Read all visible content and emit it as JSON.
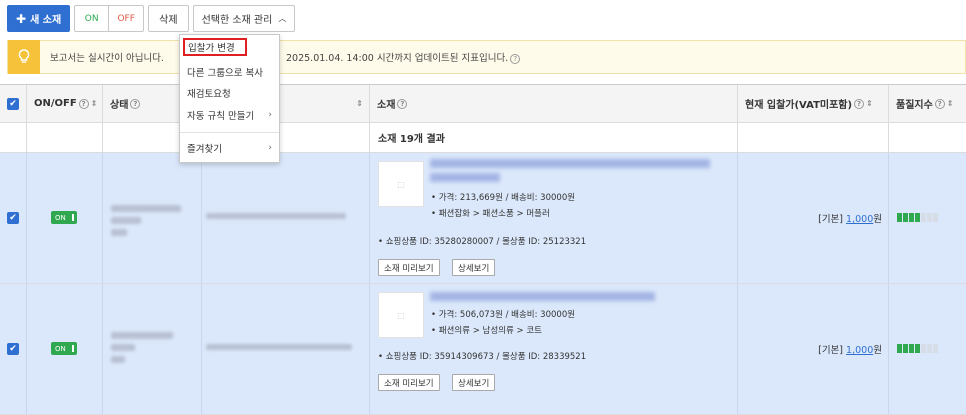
{
  "toolbar": {
    "new_label": "새 소재",
    "on_label": "ON",
    "off_label": "OFF",
    "delete_label": "삭제",
    "manage_label": "선택한 소재 관리"
  },
  "notice": {
    "text_a": "보고서는 실시간이 아닙니다.",
    "text_b": "2025.01.04. 14:00 시간까지 업데이트된 지표입니다."
  },
  "dropdown": {
    "items": [
      "입찰가 변경",
      "다른 그룹으로 복사",
      "재검토요청",
      "자동 규칙 만들기",
      "즐겨찾기"
    ]
  },
  "table": {
    "headers": {
      "onoff": "ON/OFF",
      "status": "상태",
      "material": "소재",
      "bid": "현재 입찰가(VAT미포함)",
      "quality": "품질지수"
    },
    "summary": "소재 19개 결과",
    "rows": [
      {
        "toggle": "ON",
        "price": "• 가격: 213,669원 /  배송비: 30000원",
        "category": "• 패션잡화 > 패션소품 > 머플러",
        "ids": "• 쇼핑상품 ID: 35280280007   / 몰상품 ID: 25123321",
        "preview": "소재 미리보기",
        "detail": "상세보기",
        "bid_prefix": "[기본]",
        "bid_amount": "1,000",
        "bid_unit": "원",
        "quality": 4
      },
      {
        "toggle": "ON",
        "price": "• 가격: 506,073원 /  배송비: 30000원",
        "category": "• 패션의류 > 남성의류 > 코트",
        "ids": "• 쇼핑상품 ID: 35914309673   / 몰상품 ID: 28339521",
        "preview": "소재 미리보기",
        "detail": "상세보기",
        "bid_prefix": "[기본]",
        "bid_amount": "1,000",
        "bid_unit": "원",
        "quality": 4
      }
    ]
  }
}
